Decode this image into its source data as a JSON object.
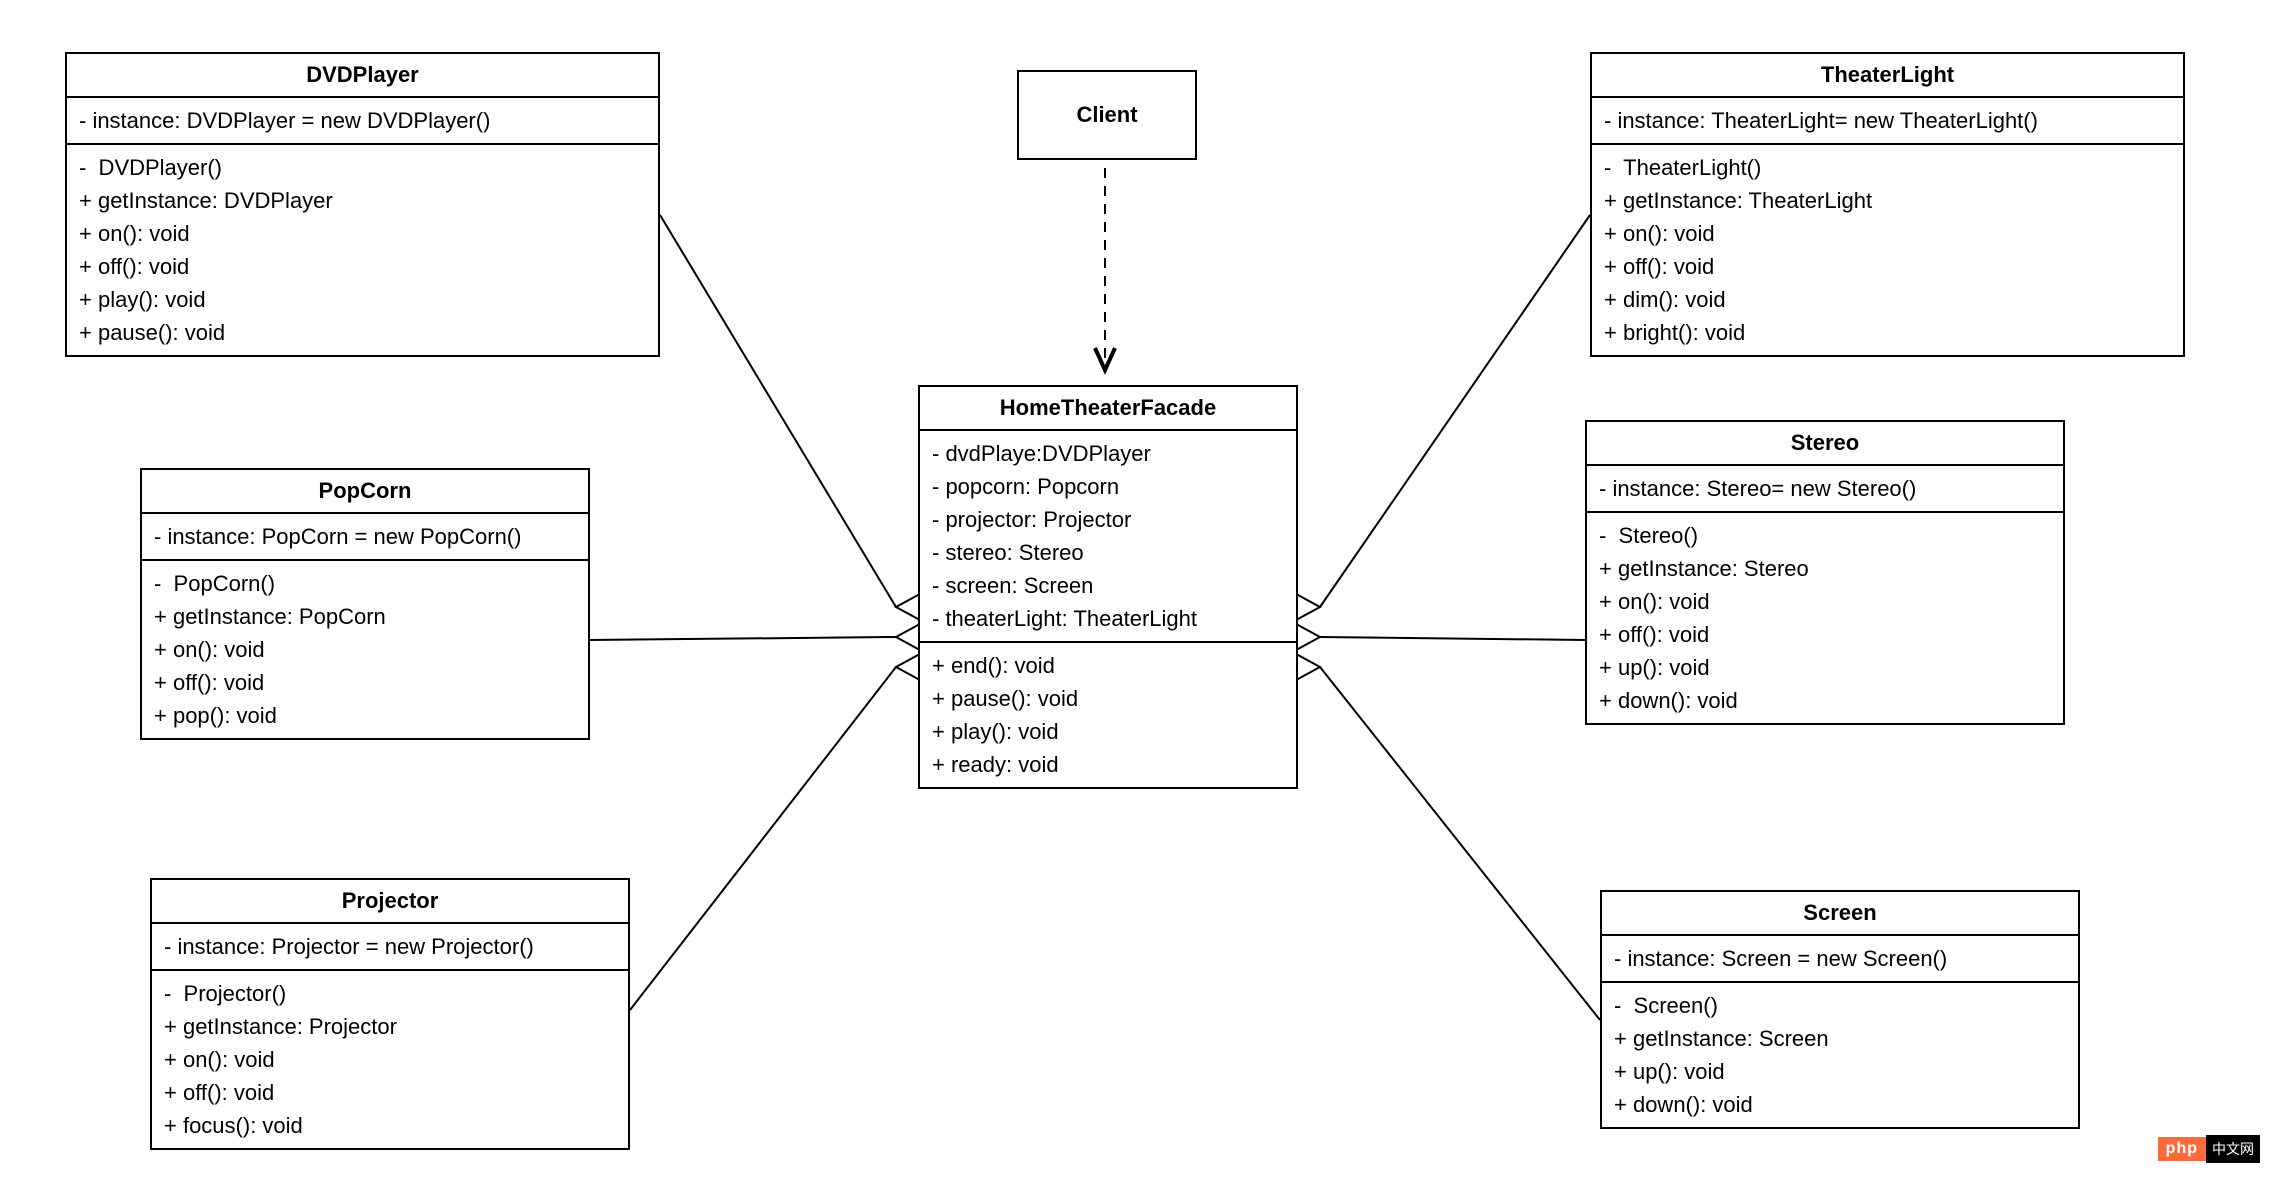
{
  "classes": {
    "client": {
      "title": "Client"
    },
    "hometheater": {
      "title": "HomeTheaterFacade",
      "attrs": [
        "- dvdPlaye:DVDPlayer",
        "- popcorn: Popcorn",
        "- projector: Projector",
        "- stereo: Stereo",
        "- screen: Screen",
        "- theaterLight: TheaterLight"
      ],
      "methods": [
        "+ end(): void",
        "+ pause(): void",
        "+ play(): void",
        "+ ready: void"
      ]
    },
    "dvdplayer": {
      "title": "DVDPlayer",
      "attrs": [
        "- instance: DVDPlayer = new DVDPlayer()"
      ],
      "methods": [
        "-  DVDPlayer()",
        "+ getInstance: DVDPlayer",
        "+ on(): void",
        "+ off(): void",
        "+ play(): void",
        "+ pause(): void"
      ]
    },
    "popcorn": {
      "title": "PopCorn",
      "attrs": [
        "- instance: PopCorn = new PopCorn()"
      ],
      "methods": [
        "-  PopCorn()",
        "+ getInstance: PopCorn",
        "+ on(): void",
        "+ off(): void",
        "+ pop(): void"
      ]
    },
    "projector": {
      "title": "Projector",
      "attrs": [
        "- instance: Projector = new Projector()"
      ],
      "methods": [
        "-  Projector()",
        "+ getInstance: Projector",
        "+ on(): void",
        "+ off(): void",
        "+ focus(): void"
      ]
    },
    "theaterlight": {
      "title": "TheaterLight",
      "attrs": [
        "- instance: TheaterLight= new TheaterLight()"
      ],
      "methods": [
        "-  TheaterLight()",
        "+ getInstance: TheaterLight",
        "+ on(): void",
        "+ off(): void",
        "+ dim(): void",
        "+ bright(): void"
      ]
    },
    "stereo": {
      "title": "Stereo",
      "attrs": [
        "- instance: Stereo= new Stereo()"
      ],
      "methods": [
        "-  Stereo()",
        "+ getInstance: Stereo",
        "+ on(): void",
        "+ off(): void",
        "+ up(): void",
        "+ down(): void"
      ]
    },
    "screen": {
      "title": "Screen",
      "attrs": [
        "- instance: Screen = new Screen()"
      ],
      "methods": [
        "-  Screen()",
        "+ getInstance: Screen",
        "+ up(): void",
        "+ down(): void"
      ]
    }
  },
  "watermark": {
    "left": "php",
    "right": "中文网"
  }
}
